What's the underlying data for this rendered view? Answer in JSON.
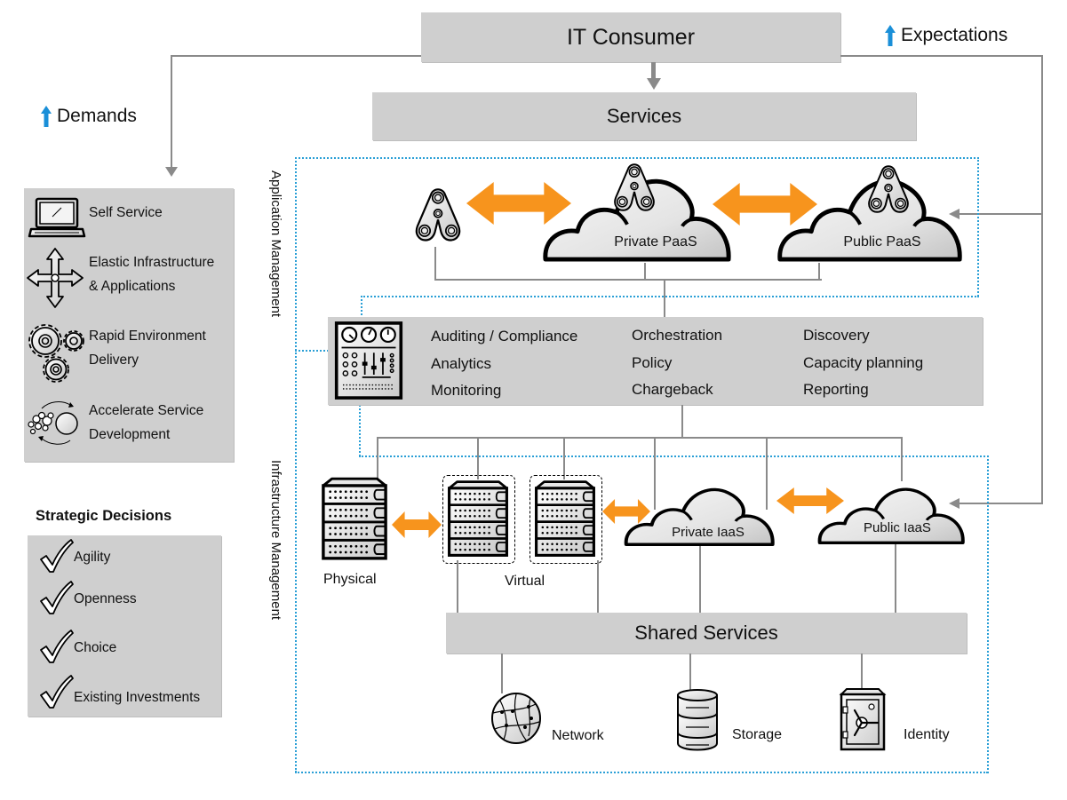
{
  "header": {
    "it_consumer": "IT Consumer",
    "services": "Services",
    "demands": "Demands",
    "expectations": "Expectations"
  },
  "left_panel": {
    "items": [
      {
        "icon": "laptop-icon",
        "lines": [
          "Self Service"
        ]
      },
      {
        "icon": "four-way-arrows-icon",
        "lines": [
          "Elastic Infrastructure",
          "& Applications"
        ]
      },
      {
        "icon": "gears-icon",
        "lines": [
          "Rapid Environment",
          "Delivery"
        ]
      },
      {
        "icon": "molecules-cycle-icon",
        "lines": [
          "Accelerate Service",
          "Development"
        ]
      }
    ]
  },
  "strategic": {
    "title": "Strategic Decisions",
    "items": [
      "Agility",
      "Openness",
      "Choice",
      "Existing Investments"
    ]
  },
  "sections": {
    "application_management": "Application Management",
    "infrastructure_management": "Infrastructure Management"
  },
  "paas": {
    "private": "Private PaaS",
    "public": "Public PaaS"
  },
  "management_bar": {
    "col1": [
      "Auditing / Compliance",
      "Analytics",
      "Monitoring"
    ],
    "col2": [
      "Orchestration",
      "Policy",
      "Chargeback"
    ],
    "col3": [
      "Discovery",
      "Capacity planning",
      "Reporting"
    ]
  },
  "infrastructure": {
    "physical": "Physical",
    "virtual": "Virtual",
    "private_iaas": "Private IaaS",
    "public_iaas": "Public IaaS",
    "shared_services": "Shared Services",
    "network": "Network",
    "storage": "Storage",
    "identity": "Identity"
  },
  "colors": {
    "box_gray": "#cfcfcf",
    "connector_gray": "#8a8a8a",
    "orange_arrow": "#f7941d",
    "dotted_blue": "#2a9fd6",
    "up_arrow_blue": "#1a8fd8"
  }
}
